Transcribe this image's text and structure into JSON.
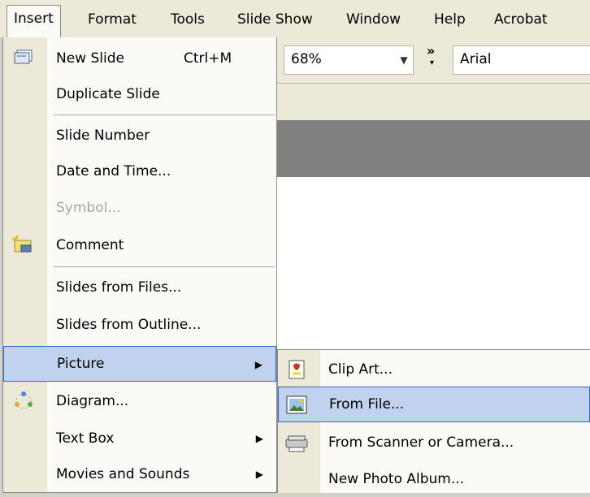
{
  "menubar": {
    "items": [
      {
        "label": "Insert",
        "active": true
      },
      {
        "label": "Format"
      },
      {
        "label": "Tools"
      },
      {
        "label": "Slide Show"
      },
      {
        "label": "Window"
      },
      {
        "label": "Help"
      },
      {
        "label": "Acrobat"
      }
    ]
  },
  "toolbar": {
    "zoom": "68%",
    "font": "Arial"
  },
  "insert_menu": {
    "items": [
      {
        "label": "New Slide",
        "shortcut": "Ctrl+M",
        "icon": "new-slide-icon"
      },
      {
        "label": "Duplicate Slide"
      },
      {
        "label": "Slide Number"
      },
      {
        "label": "Date and Time..."
      },
      {
        "label": "Symbol...",
        "disabled": true
      },
      {
        "label": "Comment",
        "icon": "comment-icon"
      },
      {
        "label": "Slides from Files..."
      },
      {
        "label": "Slides from Outline..."
      },
      {
        "label": "Picture",
        "submenu": true,
        "highlighted": true
      },
      {
        "label": "Diagram...",
        "icon": "diagram-icon"
      },
      {
        "label": "Text Box",
        "submenu": true
      },
      {
        "label": "Movies and Sounds",
        "submenu": true
      }
    ]
  },
  "picture_submenu": {
    "items": [
      {
        "label": "Clip Art...",
        "icon": "clip-art-icon"
      },
      {
        "label": "From File...",
        "icon": "picture-file-icon",
        "highlighted": true
      },
      {
        "label": "From Scanner or Camera...",
        "icon": "scanner-icon"
      },
      {
        "label": "New Photo Album..."
      }
    ]
  },
  "colors": {
    "menu_bg": "#fbfaf6",
    "gutter": "#ece9d8",
    "highlight_fill": "#c1d2ee",
    "highlight_border": "#316ac5",
    "disabled_text": "#a7a6aa"
  }
}
